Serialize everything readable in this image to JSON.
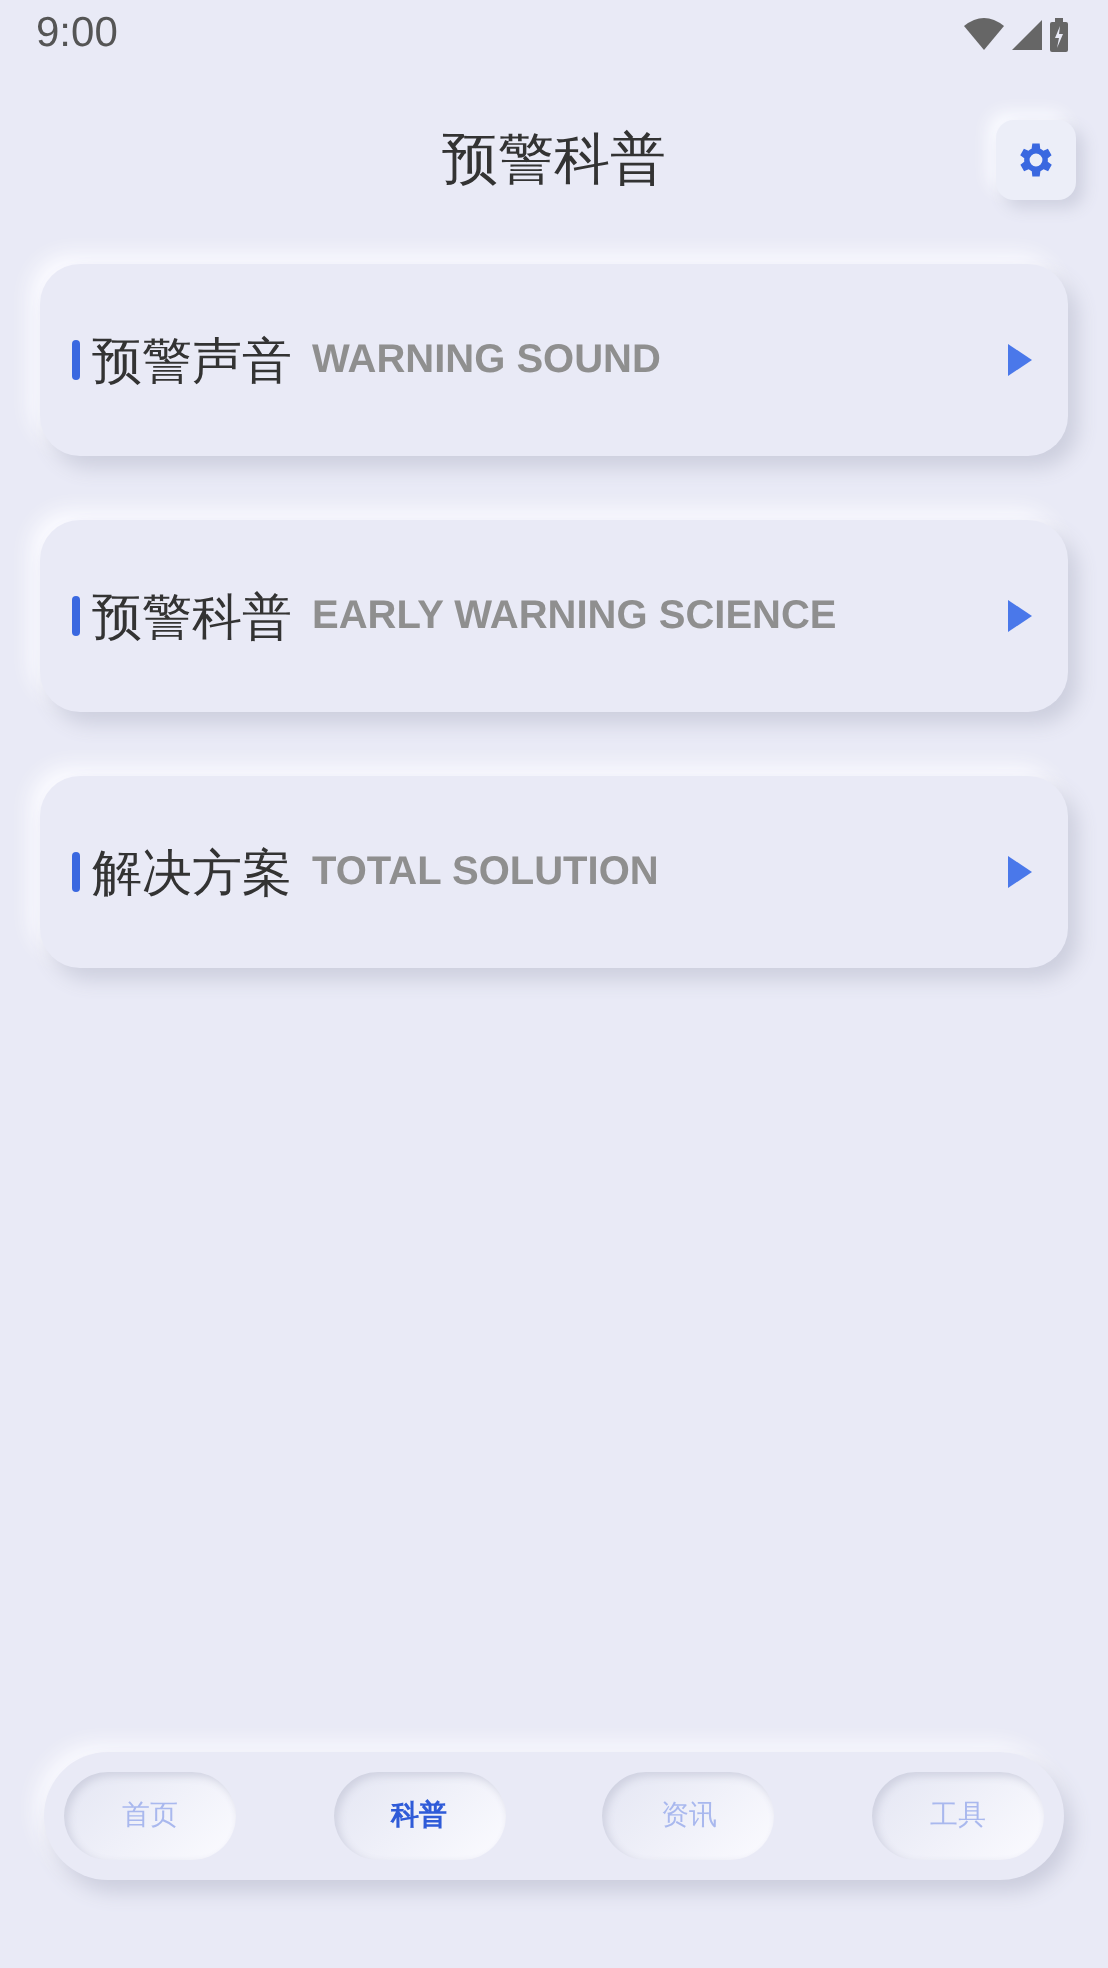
{
  "status_bar": {
    "time": "9:00"
  },
  "header": {
    "title": "预警科普"
  },
  "cards": [
    {
      "title": "预警声音",
      "subtitle": "WARNING SOUND"
    },
    {
      "title": "预警科普",
      "subtitle": "EARLY WARNING SCIENCE"
    },
    {
      "title": "解决方案",
      "subtitle": "TOTAL SOLUTION"
    }
  ],
  "tabs": [
    {
      "label": "首页",
      "selected": false
    },
    {
      "label": "科普",
      "selected": true
    },
    {
      "label": "资讯",
      "selected": false
    },
    {
      "label": "工具",
      "selected": false
    }
  ]
}
